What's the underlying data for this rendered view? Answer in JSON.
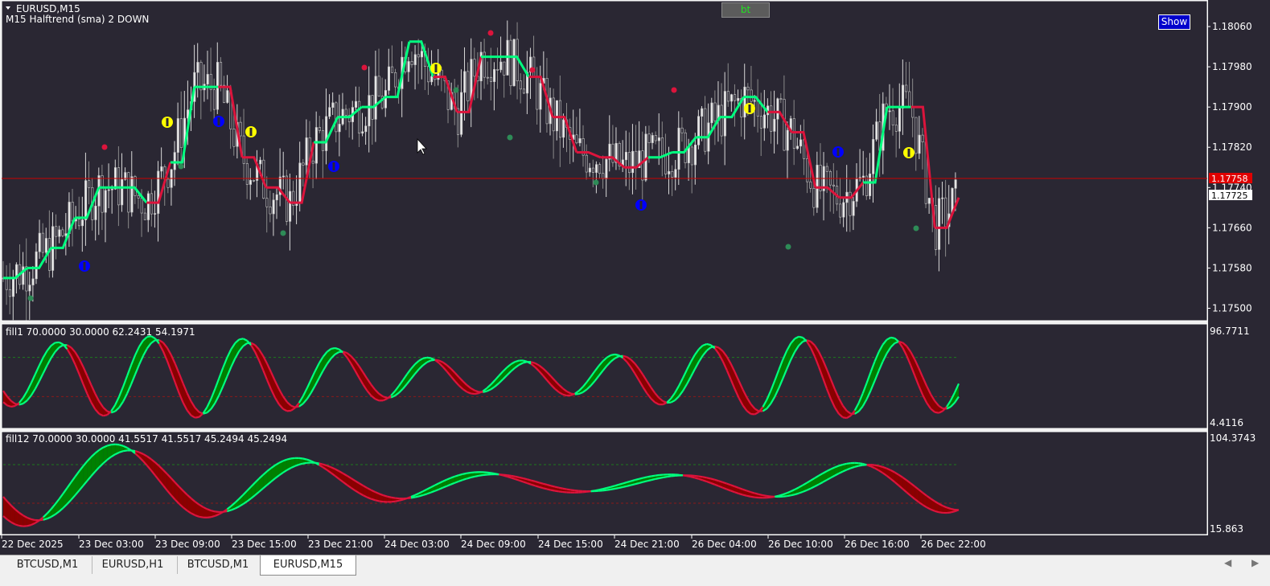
{
  "main": {
    "symbol_label": "EURUSD,M15",
    "indicator_label": "M15 Halftrend (sma) 2 DOWN",
    "y_ticks": [
      "1.18060",
      "1.17980",
      "1.17900",
      "1.17820",
      "1.17740",
      "1.17660",
      "1.17580",
      "1.17500"
    ],
    "price_tag_ask": "1.17758",
    "price_tag_bid": "1.17725",
    "bt_label": "bt",
    "show_label": "Show"
  },
  "sub1": {
    "label": "fill1 70.0000 30.0000 62.2431 54.1971",
    "max": "96.7711",
    "min": "4.4116"
  },
  "sub2": {
    "label": "fill12 70.0000 30.0000 41.5517 41.5517 45.2494 45.2494",
    "max": "104.3743",
    "min": "15.863"
  },
  "x_ticks": [
    "22 Dec 2025",
    "23 Dec 03:00",
    "23 Dec 09:00",
    "23 Dec 15:00",
    "23 Dec 21:00",
    "24 Dec 03:00",
    "24 Dec 09:00",
    "24 Dec 15:00",
    "24 Dec 21:00",
    "26 Dec 04:00",
    "26 Dec 10:00",
    "26 Dec 16:00",
    "26 Dec 22:00"
  ],
  "tabs": [
    "BTCUSD,M1",
    "EURUSD,H1",
    "BTCUSD,M1",
    "EURUSD,M15"
  ],
  "active_tab": 3,
  "colors": {
    "bg": "#2a2733",
    "up": "#00ff7f",
    "down": "#dc143c",
    "fill_up": "#008000",
    "fill_down": "#8b0000",
    "arrow_up": "#0000ff",
    "arrow_down": "#ffff00"
  },
  "chart_data": {
    "type": "line",
    "halftrend": {
      "x": [
        0,
        0.02,
        0.04,
        0.06,
        0.08,
        0.1,
        0.12,
        0.14,
        0.16,
        0.18,
        0.2,
        0.22,
        0.24,
        0.26,
        0.28,
        0.3,
        0.32,
        0.34,
        0.36,
        0.38,
        0.4,
        0.42,
        0.44,
        0.46,
        0.48,
        0.5,
        0.52,
        0.54,
        0.56,
        0.58,
        0.6,
        0.62,
        0.64,
        0.66,
        0.68,
        0.7,
        0.72,
        0.74,
        0.76,
        0.78,
        0.8
      ],
      "values": [
        1.1756,
        1.1758,
        1.1762,
        1.1768,
        1.1774,
        1.1774,
        1.1771,
        1.1779,
        1.1794,
        1.1794,
        1.178,
        1.1774,
        1.1771,
        1.1783,
        1.1788,
        1.179,
        1.1792,
        1.1803,
        1.1796,
        1.1789,
        1.18,
        1.18,
        1.1796,
        1.1788,
        1.1781,
        1.178,
        1.1778,
        1.178,
        1.1781,
        1.1784,
        1.1788,
        1.1792,
        1.1789,
        1.1785,
        1.1774,
        1.1772,
        1.1775,
        1.179,
        1.179,
        1.1766,
        1.1772
      ],
      "trend": [
        "up",
        "up",
        "up",
        "up",
        "up",
        "up",
        "down",
        "up",
        "up",
        "down",
        "down",
        "down",
        "down",
        "up",
        "up",
        "up",
        "up",
        "up",
        "down",
        "down",
        "up",
        "up",
        "down",
        "down",
        "down",
        "down",
        "down",
        "up",
        "up",
        "up",
        "up",
        "up",
        "down",
        "down",
        "down",
        "down",
        "up",
        "up",
        "down",
        "down",
        "up"
      ]
    },
    "last_price": 1.17758
  }
}
